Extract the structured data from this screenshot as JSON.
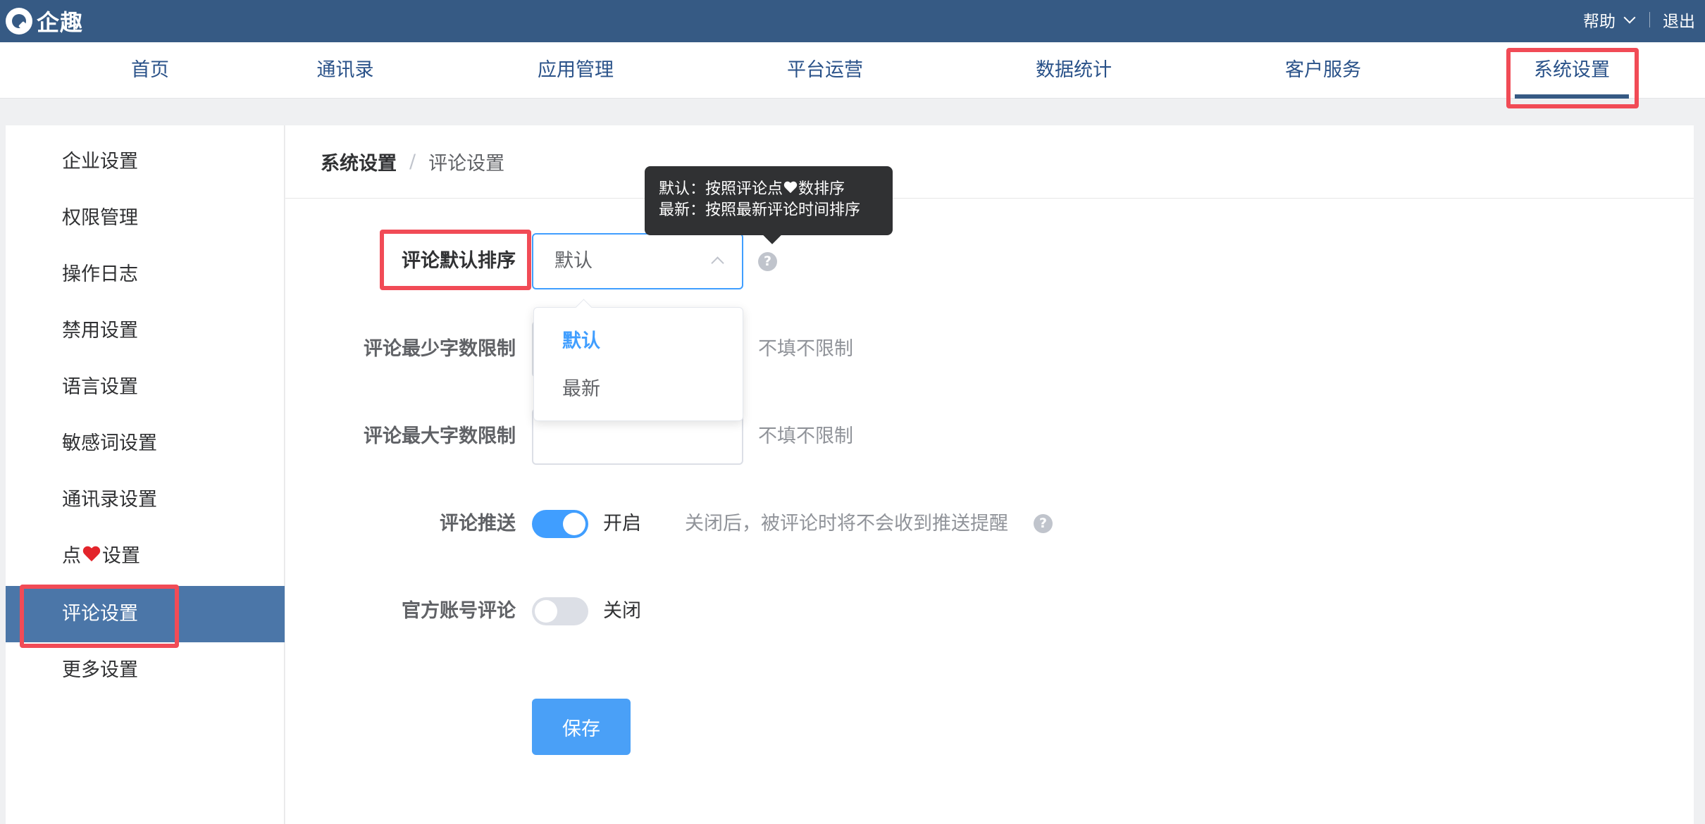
{
  "app": {
    "name": "企趣"
  },
  "header": {
    "help_label": "帮助",
    "logout_label": "退出"
  },
  "nav": [
    {
      "label": "首页"
    },
    {
      "label": "通讯录"
    },
    {
      "label": "应用管理"
    },
    {
      "label": "平台运营"
    },
    {
      "label": "数据统计"
    },
    {
      "label": "客户服务"
    },
    {
      "label": "系统设置",
      "active": true
    }
  ],
  "sidebar": {
    "items": [
      {
        "label": "企业设置"
      },
      {
        "label": "权限管理"
      },
      {
        "label": "操作日志"
      },
      {
        "label": "禁用设置"
      },
      {
        "label": "语言设置"
      },
      {
        "label": "敏感词设置"
      },
      {
        "label": "通讯录设置"
      },
      {
        "label_prefix": "点",
        "label_suffix": "设置"
      },
      {
        "label": "评论设置",
        "active": true
      },
      {
        "label": "更多设置"
      }
    ]
  },
  "breadcrumb": {
    "root": "系统设置",
    "separator": "/",
    "current": "评论设置"
  },
  "form": {
    "sort": {
      "label": "评论默认排序",
      "value": "默认",
      "options": [
        "默认",
        "最新"
      ],
      "tooltip_line1_prefix": "默认：按照评论点",
      "tooltip_line1_suffix": "数排序",
      "tooltip_line2": "最新：按照最新评论时间排序"
    },
    "min_len": {
      "label": "评论最少字数限制",
      "hint": "不填不限制"
    },
    "max_len": {
      "label": "评论最大字数限制",
      "hint": "不填不限制"
    },
    "push": {
      "label": "评论推送",
      "state": "开启",
      "on": true,
      "hint": "关闭后，被评论时将不会收到推送提醒"
    },
    "official": {
      "label": "官方账号评论",
      "state": "关闭",
      "on": false
    },
    "save_label": "保存"
  },
  "colors": {
    "header_bg": "#365a84",
    "sidebar_active": "#4b76a8",
    "primary": "#409eff",
    "highlight": "#f14b56"
  }
}
